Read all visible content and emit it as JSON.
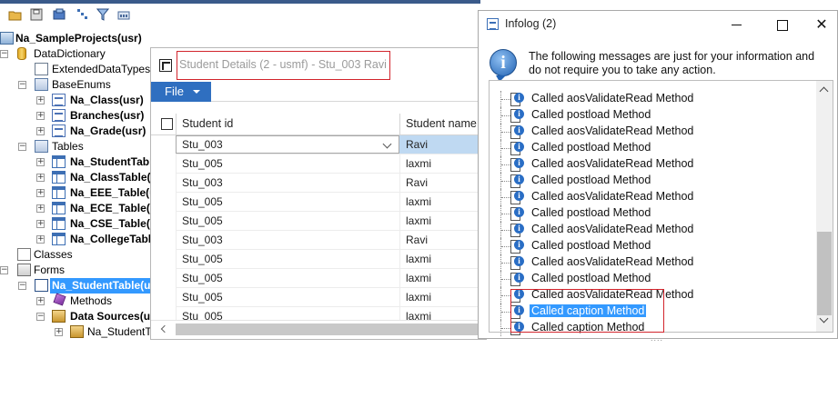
{
  "toolbar": {
    "icons": [
      "open-folder-icon",
      "save-icon",
      "compile-icon",
      "properties-icon",
      "filter-icon",
      "import-icon"
    ]
  },
  "tree": {
    "project_title": "Na_SampleProjects(usr)",
    "data_dictionary": "DataDictionary",
    "extended_data_types": "ExtendedDataTypes",
    "base_enums": "BaseEnums",
    "enums": [
      "Na_Class(usr)",
      "Branches(usr)",
      "Na_Grade(usr)"
    ],
    "tables": "Tables",
    "table_items": [
      "Na_StudentTable(usr)",
      "Na_ClassTable(usr)",
      "Na_EEE_Table(usr)",
      "Na_ECE_Table(usr)",
      "Na_CSE_Table(usr)",
      "Na_CollegeTable(usr)"
    ],
    "classes": "Classes",
    "forms": "Forms",
    "selected_form": "Na_StudentTable(usr)",
    "methods": "Methods",
    "data_sources": "Data Sources(usr)",
    "data_source_item": "Na_StudentTable"
  },
  "student_window": {
    "title": "Student Details (2 - usmf) - Stu_003 Ravi",
    "file_menu": "File",
    "columns": [
      "Student id",
      "Student name"
    ],
    "rows": [
      [
        "Stu_003",
        "Ravi"
      ],
      [
        "Stu_005",
        "laxmi"
      ],
      [
        "Stu_003",
        "Ravi"
      ],
      [
        "Stu_005",
        "laxmi"
      ],
      [
        "Stu_005",
        "laxmi"
      ],
      [
        "Stu_003",
        "Ravi"
      ],
      [
        "Stu_005",
        "laxmi"
      ],
      [
        "Stu_005",
        "laxmi"
      ],
      [
        "Stu_005",
        "laxmi"
      ],
      [
        "Stu_005",
        "laxmi"
      ]
    ]
  },
  "infolog": {
    "title": "Infolog (2)",
    "message": "The following messages are just for your information and do not require you to take any action.",
    "items": [
      "Called aosValidateRead Method",
      "Called postload Method",
      "Called aosValidateRead Method",
      "Called postload Method",
      "Called aosValidateRead Method",
      "Called postload Method",
      "Called aosValidateRead Method",
      "Called postload Method",
      "Called aosValidateRead Method",
      "Called postload Method",
      "Called aosValidateRead Method",
      "Called postload Method",
      "Called aosValidateRead Method",
      "Called caption Method",
      "Called caption Method"
    ],
    "selected_index": 13,
    "grip": "....",
    "close_glyph": "✕"
  },
  "colors": {
    "selection": "#3399ff",
    "file_menu": "#2f6fc0",
    "highlight_box": "#d2242c"
  }
}
